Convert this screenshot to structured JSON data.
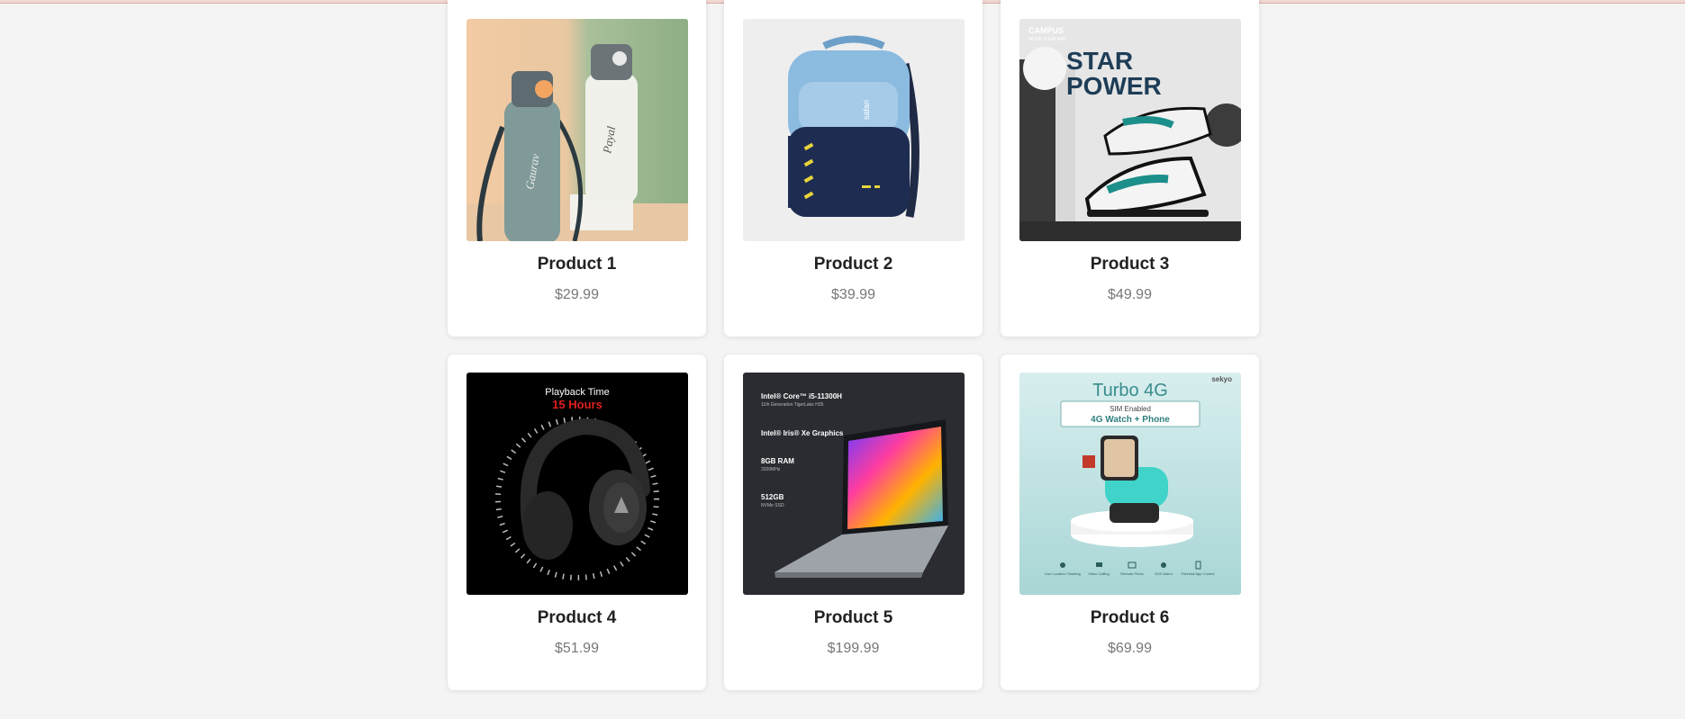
{
  "products": [
    {
      "name": "Product 1",
      "price": "$29.99",
      "image": "water-bottles-image"
    },
    {
      "name": "Product 2",
      "price": "$39.99",
      "image": "backpack-image"
    },
    {
      "name": "Product 3",
      "price": "$49.99",
      "image": "sneakers-image",
      "image_text": {
        "brand": "CAMPUS",
        "tagline": "MOVE YOUR WAY",
        "headline1": "STAR",
        "headline2": "POWER"
      }
    },
    {
      "name": "Product 4",
      "price": "$51.99",
      "image": "headphones-image",
      "image_text": {
        "line1": "Playback Time",
        "line2": "15 Hours"
      }
    },
    {
      "name": "Product 5",
      "price": "$199.99",
      "image": "laptop-image",
      "image_text": {
        "cpu": "Intel® Core™ i5-11300H",
        "cpu_sub": "11th Generation TigerLake H35",
        "gpu": "Intel® Iris® Xe Graphics",
        "ram": "8GB RAM",
        "ram_sub": "3200MHz",
        "ssd": "512GB",
        "ssd_sub": "NVMe SSD"
      }
    },
    {
      "name": "Product 6",
      "price": "$69.99",
      "image": "smartwatch-image",
      "image_text": {
        "title": "Turbo 4G",
        "brand": "sekyo",
        "sim": "SIM Enabled",
        "feature": "4G Watch + Phone",
        "icons": [
          "Live Location Tracking",
          "Video Calling",
          "Remote Photo",
          "SOS Alarm",
          "Parental App Control"
        ]
      }
    }
  ],
  "colors": {
    "background": "#f4f4f4",
    "card": "#ffffff",
    "title": "#222222",
    "price": "#777777"
  }
}
